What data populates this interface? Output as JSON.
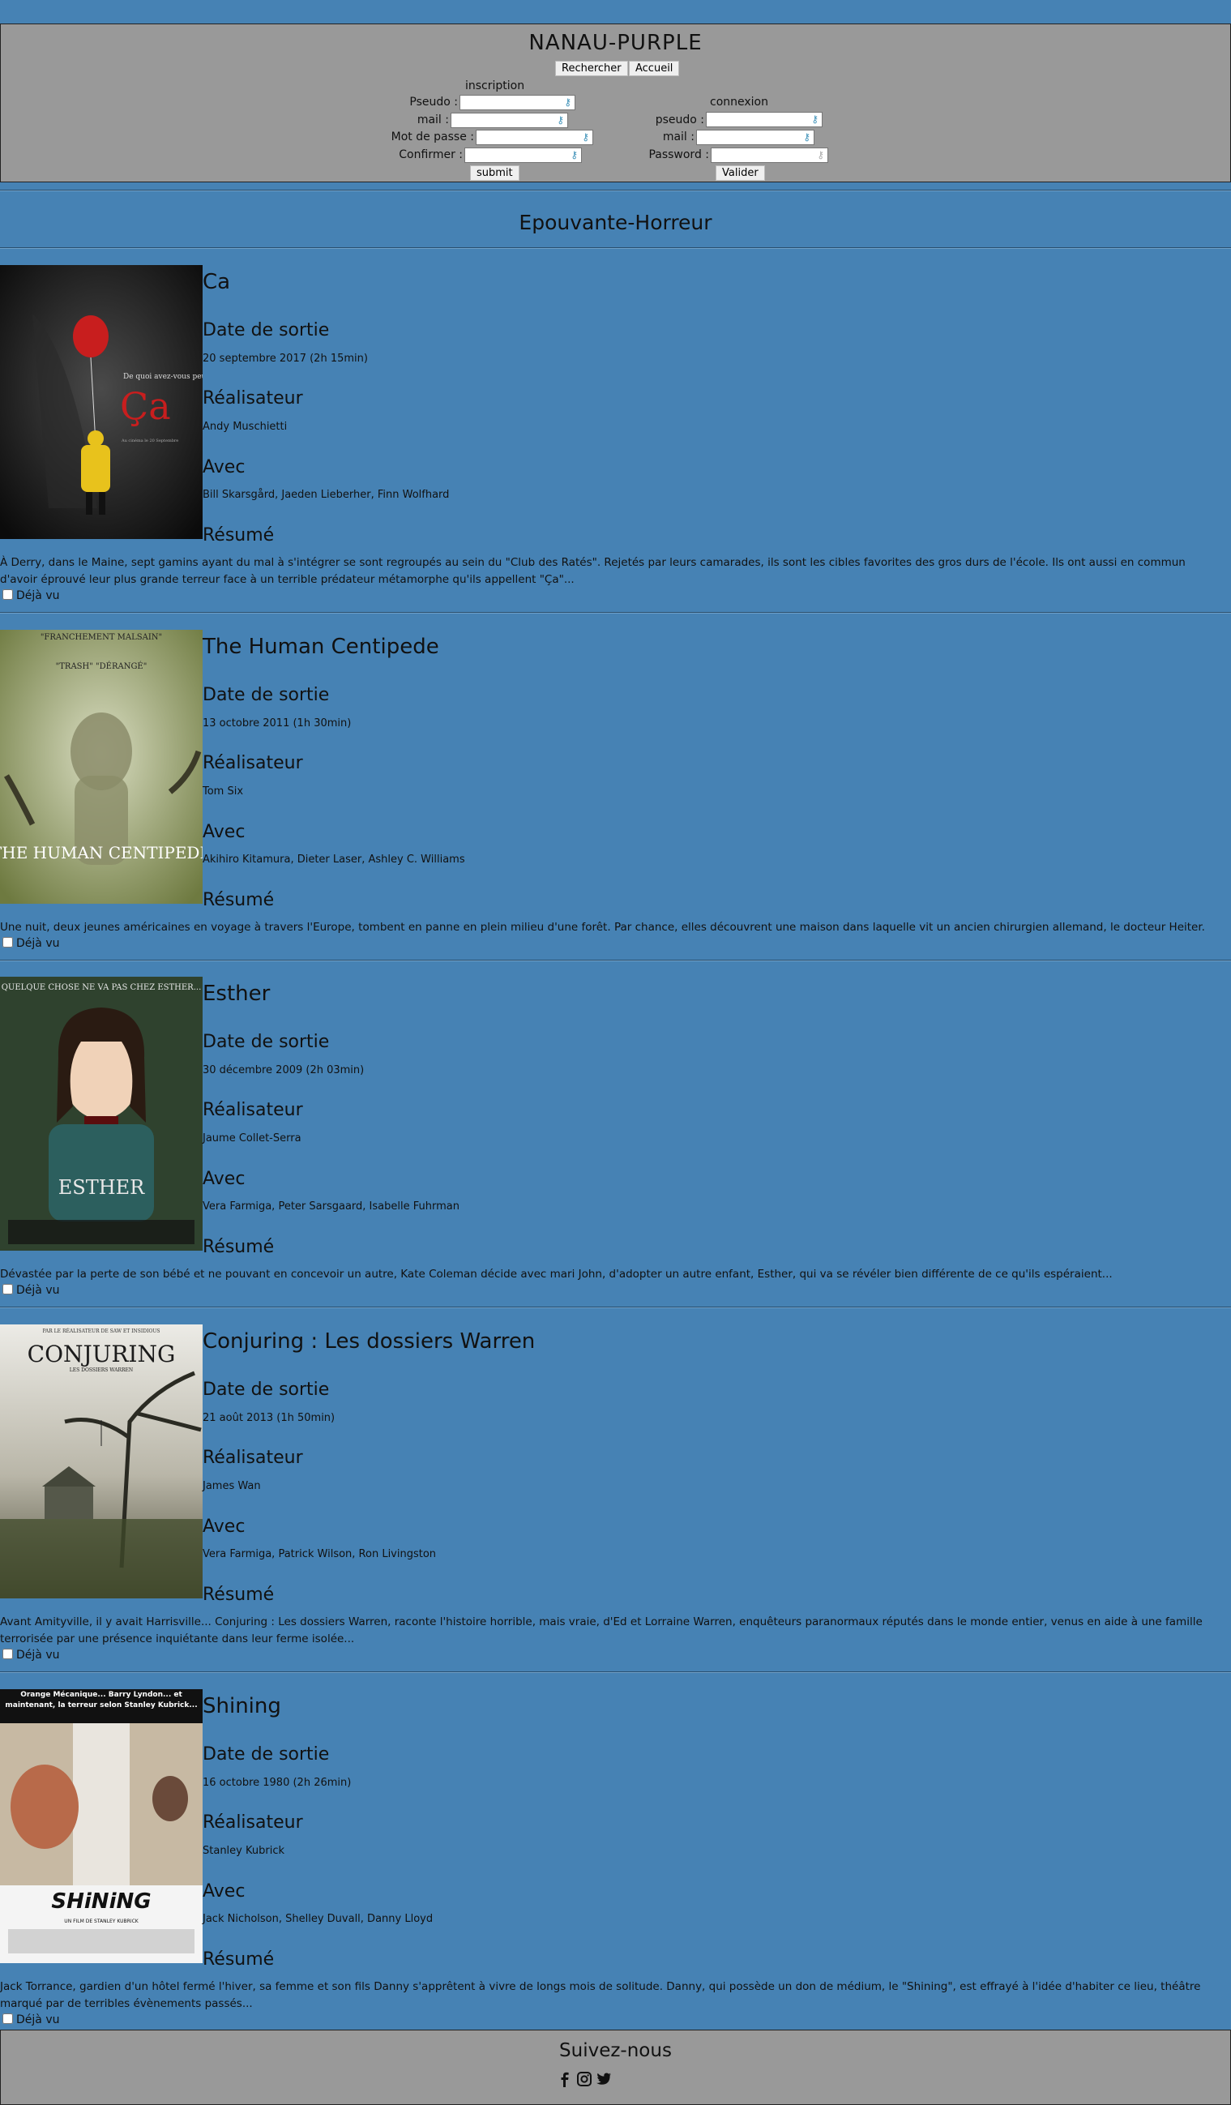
{
  "site": {
    "title": "NANAU-PURPLE"
  },
  "nav": {
    "search_label": "Rechercher",
    "home_label": "Accueil"
  },
  "inscription": {
    "title": "inscription",
    "pseudo_label": "Pseudo :",
    "mail_label": "mail :",
    "password_label": "Mot de passe :",
    "confirm_label": "Confirmer :",
    "submit_label": "submit"
  },
  "connexion": {
    "title": "connexion",
    "pseudo_label": "pseudo :",
    "mail_label": "mail :",
    "password_label": "Password :",
    "submit_label": "Valider"
  },
  "section": {
    "title": "Epouvante-Horreur"
  },
  "labels": {
    "release": "Date de sortie",
    "director": "Réalisateur",
    "cast": "Avec",
    "summary": "Résumé",
    "seen": "Déjà vu"
  },
  "movies": [
    {
      "title": "Ca",
      "release": "20 septembre 2017 (2h 15min)",
      "director": "Andy Muschietti",
      "cast": "Bill Skarsgård, Jaeden Lieberher, Finn Wolfhard",
      "summary": "À Derry, dans le Maine, sept gamins ayant du mal à s'intégrer se sont regroupés au sein du \"Club des Ratés\". Rejetés par leurs camarades, ils sont les cibles favorites des gros durs de l'école. Ils ont aussi en commun d'avoir éprouvé leur plus grande terreur face à un terrible prédateur métamorphe qu'ils appellent \"Ça\"...",
      "poster_text": "De quoi avez-vous peur?",
      "poster_title": "Ça",
      "poster_sub": "Au cinéma le 20 Septembre"
    },
    {
      "title": "The Human Centipede",
      "release": "13 octobre 2011 (1h 30min)",
      "director": "Tom Six",
      "cast": "Akihiro Kitamura, Dieter Laser, Ashley C. Williams",
      "summary": "Une nuit, deux jeunes américaines en voyage à travers l'Europe, tombent en panne en plein milieu d'une forêt. Par chance, elles découvrent une maison dans laquelle vit un ancien chirurgien allemand, le docteur Heiter.",
      "poster_text": "\"FRANCHEMENT MALSAIN\"",
      "poster_title": "THE HUMAN CENTIPEDE",
      "poster_sub": "\"TRASH\"   \"DÉRANGÉ\""
    },
    {
      "title": "Esther",
      "release": "30 décembre 2009 (2h 03min)",
      "director": "Jaume Collet-Serra",
      "cast": "Vera Farmiga, Peter Sarsgaard, Isabelle Fuhrman",
      "summary": "Dévastée par la perte de son bébé et ne pouvant en concevoir un autre, Kate Coleman décide avec mari John, d'adopter un autre enfant, Esther, qui va se révéler bien différente de ce qu'ils espéraient...",
      "poster_text": "QUELQUE CHOSE NE VA PAS CHEZ ESTHER...",
      "poster_title": "ESTHER",
      "poster_sub": ""
    },
    {
      "title": "Conjuring : Les dossiers Warren",
      "release": "21 août 2013 (1h 50min)",
      "director": "James Wan",
      "cast": "Vera Farmiga, Patrick Wilson, Ron Livingston",
      "summary": "Avant Amityville, il y avait Harrisville... Conjuring : Les dossiers Warren, raconte l'histoire horrible, mais vraie, d'Ed et Lorraine Warren, enquêteurs paranormaux réputés dans le monde entier, venus en aide à une famille terrorisée par une présence inquiétante dans leur ferme isolée...",
      "poster_text": "PAR LE RÉALISATEUR DE SAW ET INSIDIOUS",
      "poster_title": "CONJURING",
      "poster_sub": "LES DOSSIERS WARREN"
    },
    {
      "title": "Shining",
      "release": "16 octobre 1980 (2h 26min)",
      "director": "Stanley Kubrick",
      "cast": "Jack Nicholson, Shelley Duvall, Danny Lloyd",
      "summary": "Jack Torrance, gardien d'un hôtel fermé l'hiver, sa femme et son fils Danny s'apprêtent à vivre de longs mois de solitude. Danny, qui possède un don de médium, le \"Shining\", est effrayé à l'idée d'habiter ce lieu, théâtre marqué par de terribles évènements passés...",
      "poster_text": "Orange Mécanique... Barry Lyndon... et maintenant, la terreur selon Stanley Kubrick...",
      "poster_title": "SHiNiNG",
      "poster_sub": "UN FILM DE STANLEY KUBRICK"
    }
  ],
  "footer": {
    "title": "Suivez-nous"
  },
  "icons": [
    "facebook-icon",
    "instagram-icon",
    "twitter-icon"
  ]
}
